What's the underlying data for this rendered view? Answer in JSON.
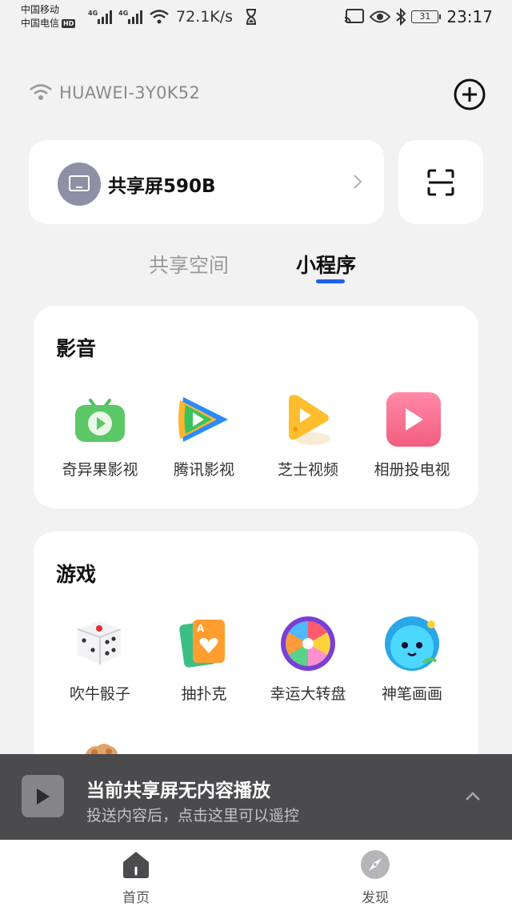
{
  "status_bar": {
    "carrier1": "中国移动",
    "carrier2": "中国电信",
    "carrier2_badge": "HD",
    "network1": "4G",
    "network2": "4G",
    "speed": "72.1K/s",
    "battery": "31",
    "time": "23:17"
  },
  "wifi": {
    "name": "HUAWEI-3Y0K52",
    "icon": "wifi-icon"
  },
  "device": {
    "name": "共享屏590B",
    "icon": "screen-icon"
  },
  "tabs": [
    {
      "label": "共享空间",
      "active": false
    },
    {
      "label": "小程序",
      "active": true
    }
  ],
  "accent_color": "#1e62e6",
  "sections": {
    "media": {
      "title": "影音",
      "apps": [
        {
          "label": "奇异果影视",
          "icon": "kiwi-tv-icon"
        },
        {
          "label": "腾讯影视",
          "icon": "tencent-video-icon"
        },
        {
          "label": "芝士视频",
          "icon": "cheese-video-icon"
        },
        {
          "label": "相册投电视",
          "icon": "photo-cast-icon"
        }
      ]
    },
    "games": {
      "title": "游戏",
      "apps": [
        {
          "label": "吹牛骰子",
          "icon": "dice-icon"
        },
        {
          "label": "抽扑克",
          "icon": "poker-card-icon"
        },
        {
          "label": "幸运大转盘",
          "icon": "lucky-wheel-icon"
        },
        {
          "label": "神笔画画",
          "icon": "magic-brush-icon"
        }
      ]
    }
  },
  "now_playing": {
    "title": "当前共享屏无内容播放",
    "subtitle": "投送内容后，点击这里可以遥控"
  },
  "bottom_nav": [
    {
      "label": "首页",
      "icon": "home-icon",
      "active": true
    },
    {
      "label": "发现",
      "icon": "compass-icon",
      "active": false
    }
  ]
}
